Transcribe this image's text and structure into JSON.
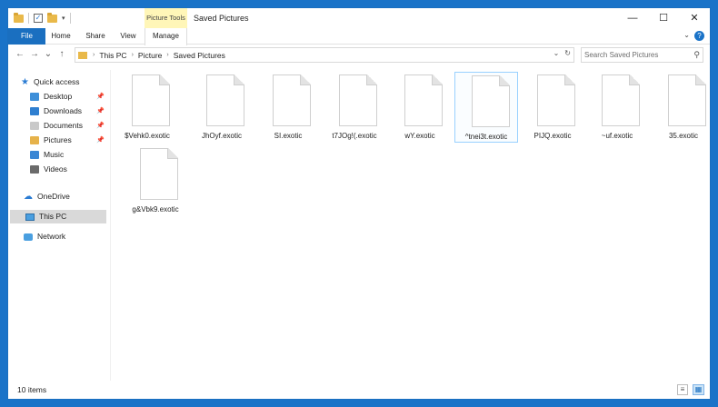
{
  "window": {
    "title": "Saved Pictures",
    "contextual_group": "Picture Tools",
    "controls": {
      "minimize": "—",
      "maximize": "☐",
      "close": "✕"
    }
  },
  "ribbon": {
    "tabs": [
      "File",
      "Home",
      "Share",
      "View",
      "Manage"
    ],
    "active_tab": "File",
    "expand_glyph": "⌄",
    "help_glyph": "?"
  },
  "address": {
    "back_glyph": "←",
    "forward_glyph": "→",
    "dropdown_glyph": "⌄",
    "up_glyph": "↑",
    "breadcrumbs": [
      "This PC",
      "Picture",
      "Saved Pictures"
    ],
    "separator": "›",
    "refresh_glyph": "↻",
    "history_glyph": "⌄"
  },
  "search": {
    "placeholder": "Search Saved Pictures",
    "icon": "search-icon"
  },
  "sidebar": {
    "items": [
      {
        "label": "Quick access",
        "icon": "star-icon"
      },
      {
        "label": "Desktop",
        "icon": "desktop-icon",
        "pinned": true
      },
      {
        "label": "Downloads",
        "icon": "downloads-icon",
        "pinned": true
      },
      {
        "label": "Documents",
        "icon": "documents-icon",
        "pinned": true
      },
      {
        "label": "Pictures",
        "icon": "pictures-icon",
        "pinned": true
      },
      {
        "label": "Music",
        "icon": "music-icon"
      },
      {
        "label": "Videos",
        "icon": "videos-icon"
      },
      {
        "label": "OneDrive",
        "icon": "cloud-icon"
      },
      {
        "label": "This PC",
        "icon": "computer-icon",
        "selected": true
      },
      {
        "label": "Network",
        "icon": "network-icon"
      }
    ]
  },
  "files": [
    {
      "name": "$Vehk0.exotic"
    },
    {
      "name": "JhOyf.exotic"
    },
    {
      "name": "SI.exotic"
    },
    {
      "name": "t7JOg!(.exotic"
    },
    {
      "name": "wY.exotic"
    },
    {
      "name": "^tnei3t.exotic",
      "selected": true
    },
    {
      "name": "PIJQ.exotic"
    },
    {
      "name": "~uf.exotic"
    },
    {
      "name": "35.exotic"
    },
    {
      "name": "g&Vbk9.exotic"
    }
  ],
  "status": {
    "item_count": "10 items",
    "details_view_glyph": "≡",
    "large_icons_glyph": "▦"
  },
  "colors": {
    "accent": "#1a6fc0",
    "contextual_tab": "#fff6b8",
    "selection": "#99d1ff",
    "folder": "#e9b94a"
  }
}
